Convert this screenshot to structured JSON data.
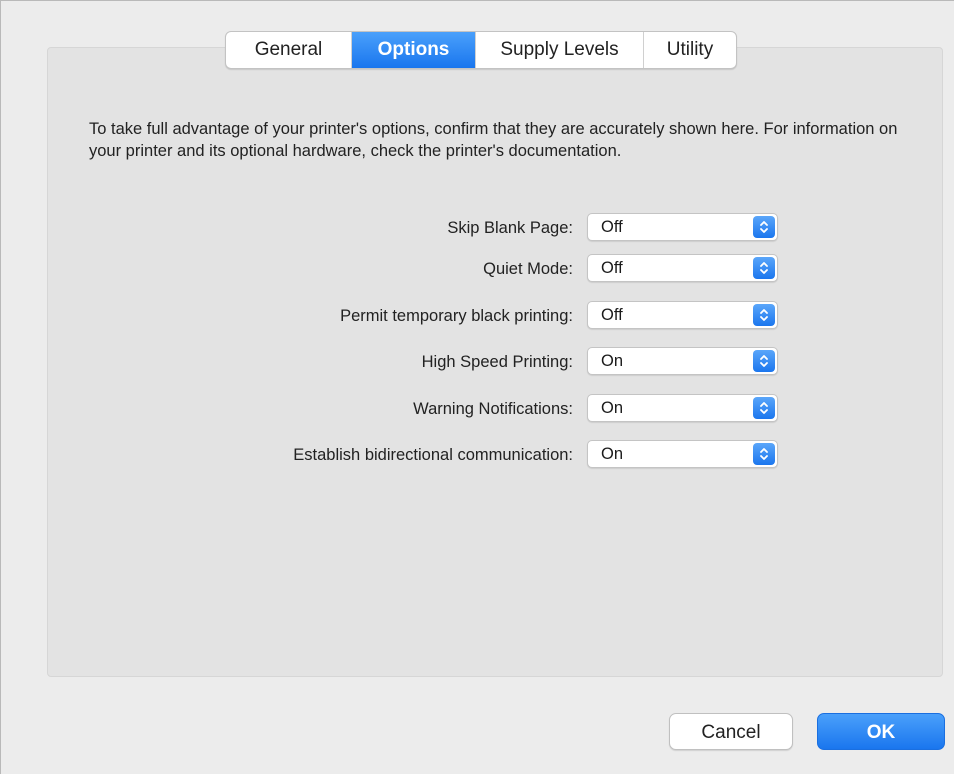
{
  "tabs": [
    {
      "label": "General",
      "active": false
    },
    {
      "label": "Options",
      "active": true
    },
    {
      "label": "Supply Levels",
      "active": false
    },
    {
      "label": "Utility",
      "active": false
    }
  ],
  "intro_text": "To take full advantage of your printer's options, confirm that they are accurately shown here. For information on your printer and its optional hardware, check the printer's documentation.",
  "options": [
    {
      "label": "Skip Blank Page:",
      "value": "Off"
    },
    {
      "label": "Quiet Mode:",
      "value": "Off"
    },
    {
      "label": "Permit temporary black printing:",
      "value": "Off"
    },
    {
      "label": "High Speed Printing:",
      "value": "On"
    },
    {
      "label": "Warning Notifications:",
      "value": "On"
    },
    {
      "label": "Establish bidirectional communication:",
      "value": "On"
    }
  ],
  "buttons": {
    "cancel_label": "Cancel",
    "ok_label": "OK"
  },
  "colors": {
    "accent": "#1a76ee",
    "panel": "#e3e3e3",
    "window": "#ececec"
  },
  "icons": {
    "select_arrow": "up-down-chevron-icon"
  }
}
